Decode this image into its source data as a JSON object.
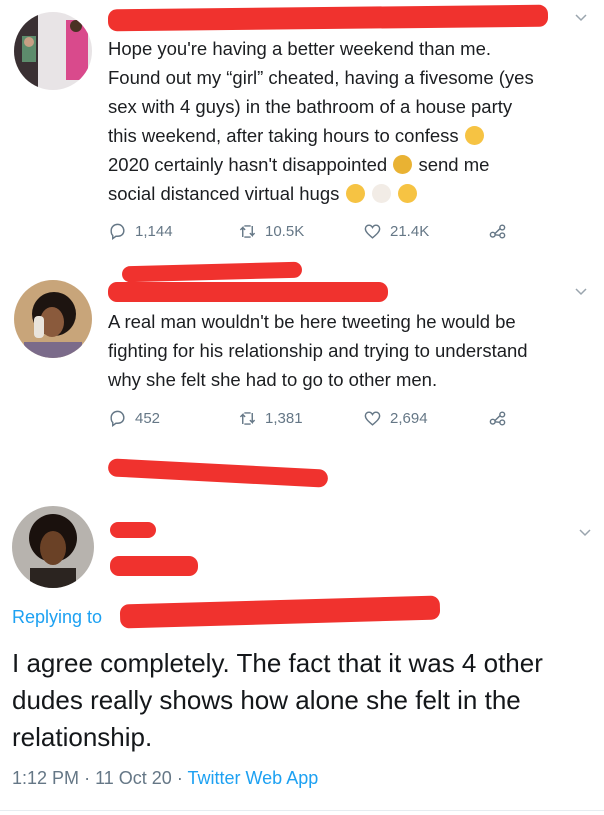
{
  "tweets": [
    {
      "text_lines": [
        "Hope you're having a better weekend than me.",
        "Found out my “girl” cheated, having a fivesome (yes",
        "sex with 4 guys) in the bathroom of a house party",
        "this weekend, after taking hours to confess",
        "2020 certainly hasn't disappointed",
        "send me",
        "social distanced virtual hugs"
      ],
      "replies": "1,144",
      "retweets": "10.5K",
      "likes": "21.4K"
    },
    {
      "text_lines": [
        "A real man wouldn't be here tweeting he would be",
        "fighting for his relationship and trying to understand",
        "why she felt she had to go to other men."
      ],
      "replies": "452",
      "retweets": "1,381",
      "likes": "2,694"
    }
  ],
  "main_tweet": {
    "replying_to": "Replying to",
    "text": "I agree completely. The fact that it was 4 other dudes really shows how alone she felt in the relationship.",
    "time": "1:12 PM",
    "date": "11 Oct 20",
    "source": "Twitter Web App",
    "separator": "·"
  },
  "icons": {
    "reply": "reply-icon",
    "retweet": "retweet-icon",
    "like": "heart-icon",
    "share": "share-icon",
    "menu": "chevron-down-icon"
  },
  "colors": {
    "redaction": "#f0322e",
    "link": "#1da1f2",
    "muted": "#657786"
  }
}
